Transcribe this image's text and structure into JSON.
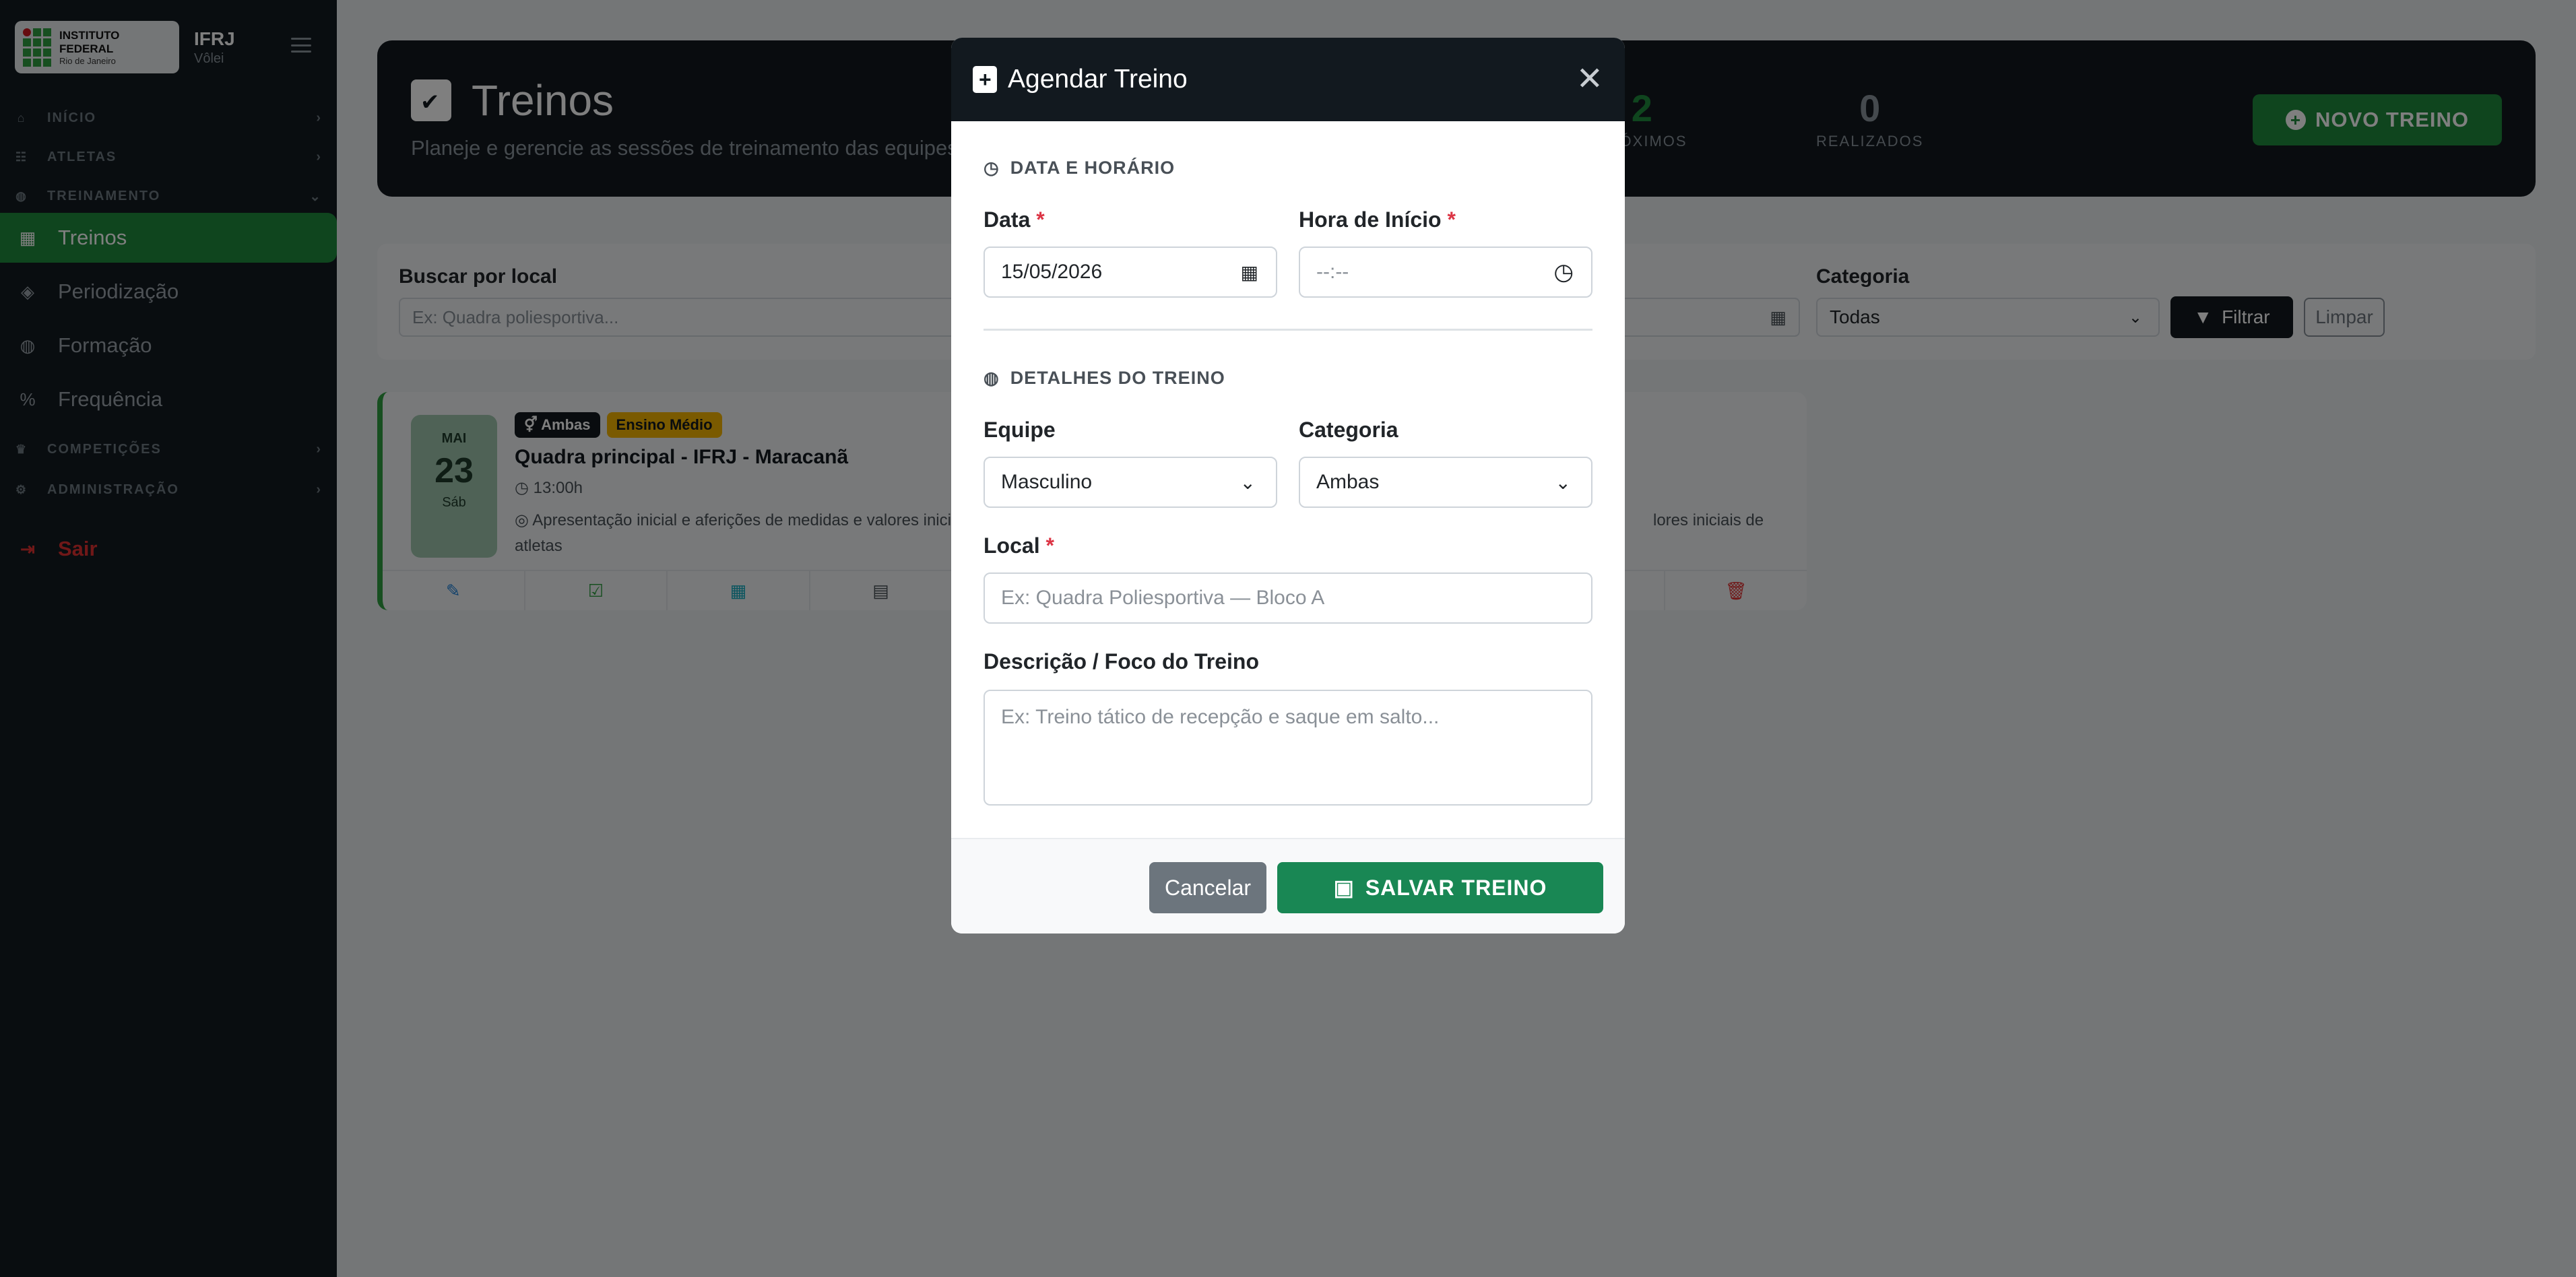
{
  "brand": {
    "logo_line1": "INSTITUTO FEDERAL",
    "logo_line2": "Rio de Janeiro",
    "name": "IFRJ",
    "subtitle": "Vôlei"
  },
  "sidebar": {
    "sections": [
      {
        "label": "INÍCIO",
        "icon": "home-icon"
      },
      {
        "label": "ATLETAS",
        "icon": "users-icon"
      },
      {
        "label": "TREINAMENTO",
        "icon": "volleyball-icon"
      },
      {
        "label": "COMPETIÇÕES",
        "icon": "trophy-icon"
      },
      {
        "label": "ADMINISTRAÇÃO",
        "icon": "gear-icon"
      }
    ],
    "items": [
      {
        "label": "Treinos",
        "icon": "calendar-check-icon",
        "active": true
      },
      {
        "label": "Periodização",
        "icon": "layers-icon"
      },
      {
        "label": "Formação",
        "icon": "volleyball-icon"
      },
      {
        "label": "Frequência",
        "icon": "percent-icon"
      }
    ],
    "logout": "Sair"
  },
  "header": {
    "title": "Treinos",
    "subtitle": "Planeje e gerencie as sessões de treinamento das equipes",
    "stats": [
      {
        "value": "2",
        "label": "PRÓXIMOS",
        "color": "#1f8a3c"
      },
      {
        "value": "0",
        "label": "REALIZADOS",
        "color": "#8a949c"
      }
    ],
    "new_button": "NOVO TREINO"
  },
  "filters": {
    "search_label": "Buscar por local",
    "search_placeholder": "Ex: Quadra poliesportiva...",
    "category_label": "Categoria",
    "category_value": "Todas",
    "filter_button": "Filtrar",
    "clear_button": "Limpar"
  },
  "treino_card": {
    "month": "MAI",
    "day": "23",
    "weekday": "Sáb",
    "badge_team": "Ambas",
    "badge_level": "Ensino Médio",
    "title": "Quadra principal - IFRJ - Maracanã",
    "time": "13:00h",
    "description_left": "Apresentação inicial e aferições de medidas e valores iniciais de",
    "description_right": "lores iniciais de",
    "description_cont": "atletas"
  },
  "modal": {
    "title": "Agendar Treino",
    "section_datetime": "DATA E HORÁRIO",
    "date_label": "Data",
    "date_value": "15/05/2026",
    "time_label": "Hora de Início",
    "time_value": "--:--",
    "section_details": "DETALHES DO TREINO",
    "team_label": "Equipe",
    "team_value": "Masculino",
    "category_label": "Categoria",
    "category_value": "Ambas",
    "local_label": "Local",
    "local_placeholder": "Ex: Quadra Poliesportiva — Bloco A",
    "desc_label": "Descrição / Foco do Treino",
    "desc_placeholder": "Ex: Treino tático de recepção e saque em salto...",
    "cancel_button": "Cancelar",
    "save_button": "SALVAR TREINO",
    "required_mark": "*"
  },
  "colors": {
    "accent_green": "#1f8a3c",
    "save_green": "#198754",
    "dark": "#12191f",
    "danger": "#dc3545"
  }
}
